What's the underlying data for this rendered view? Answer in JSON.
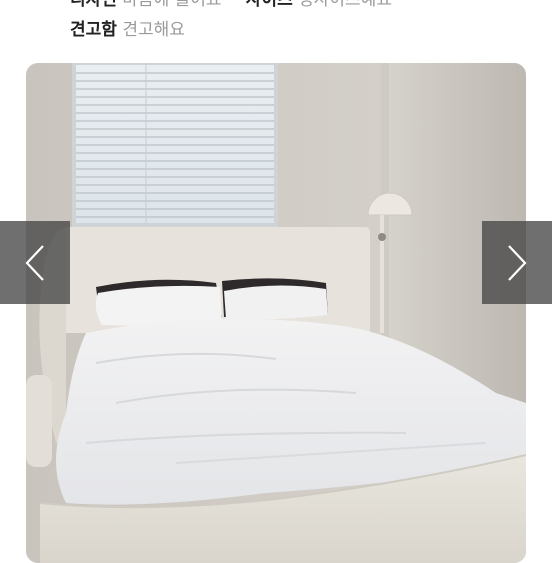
{
  "review_tags": [
    {
      "key": "디자인",
      "value": "마음에 들어요"
    },
    {
      "key": "사이즈",
      "value": "정사이즈예요"
    },
    {
      "key": "견고함",
      "value": "견고해요"
    }
  ],
  "separator": "·",
  "photo": {
    "subject": "bedroom-bed-photo"
  },
  "carousel": {
    "prev_icon": "chevron-left-icon",
    "next_icon": "chevron-right-icon"
  },
  "colors": {
    "tag_key": "#222222",
    "tag_value": "#9a9a9a",
    "arrow_bg": "#464646"
  }
}
